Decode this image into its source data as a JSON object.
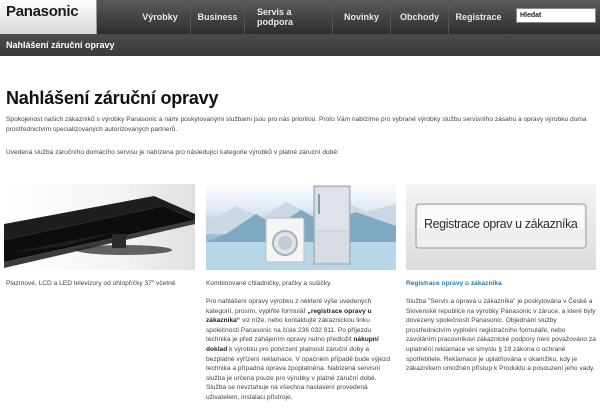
{
  "header": {
    "logo": "Panasonic",
    "nav": [
      "Výrobky",
      "Business",
      "Servis a podpora",
      "Novinky",
      "Obchody",
      "Registrace"
    ],
    "search_value": "Hledat"
  },
  "breadcrumb": "Nahlášení záruční opravy",
  "page_title": "Nahlášení záruční opravy",
  "intro": "Spokojenost našich zákazníků s výrobky Panasonic a námi poskytovanými službami jsou pro nás prioritou. Proto Vám nabízíme pro vybrané výrobky službu servisního zásahu a opravy výrobku doma prostřednictvím specializovaných autorizovaných partnerů.",
  "intro2": "Uvedená služba záručního domácího servisu je nabízena pro následující kategorie výrobků v platné záruční době:",
  "products": [
    {
      "caption": "Plazmové, LCD a LED televizory od úhlopříčky 37\" včetně"
    },
    {
      "caption": "Kombinované chladničky, pračky a sušičky."
    },
    {
      "caption": "Registrace opravy u zákazníka",
      "banner": "Registrace oprav u zákazníka"
    }
  ],
  "col2": {
    "p1": "Pro nahlášení opravy výrobku z některé výše uvedených kategorií, prosím, vyplňte formulář",
    "p1_strong": "„registrace opravy u zákazníka“",
    "p1b": "viz níže, nebo kontaktujte zákaznickou linku společnosti Panasonic na čísle 236 032 911. Po příjezdu technika je před zahájením opravy nutno předložit",
    "p1_strong2": "nákupní doklad",
    "p1c": "k výrobku pro potvrzení platnosti záruční doby a bezplatné vyřízení reklamace. V opačném případě bude výjezd technika a případná oprava zpoplatněna. Nabízená servisní služba je určena pouze pro výrobky v platné záruční době. Služba se nevztahuje na všechna nastavení provedená uživatelem, instalaci přístroje,"
  },
  "col3": {
    "text": "Služba \"Servis a oprava u zákazníka\" je poskytována v České a Slovenské republice na výrobky Panasonic v záruce, a které byly dovezeny společností Panasonic. Objednání služby prostřednictvím vyplnění registračního formuláře, nebo zavoláním pracovníkovi zákaznické podpory není považováno za uplatnění reklamace ve smyslu § 19 zákona o ochraně spotřebitele. Reklamace je uplatňována v okamžiku, kdy je zákazníkem umožněn přístup k Produktu a posouzení jeho vady."
  }
}
